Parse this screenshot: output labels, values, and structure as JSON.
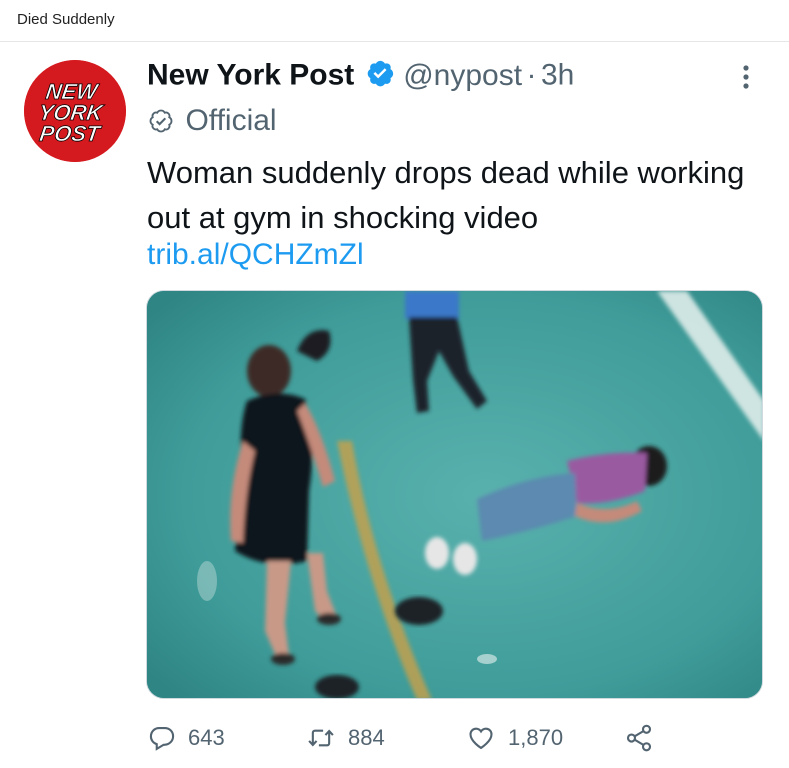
{
  "page": {
    "title": "Died Suddenly"
  },
  "tweet": {
    "author_name": "New York Post",
    "handle": "@nypost",
    "separator": "·",
    "time": "3h",
    "official_label": "Official",
    "text": "Woman suddenly drops dead while working out at gym in shocking video",
    "link": "trib.al/QCHZmZl",
    "avatar_text": [
      "NEW",
      "YORK",
      "POST"
    ],
    "verified_icon": "verified-badge-icon",
    "media_description_icon": "gym-video-thumbnail",
    "stats": {
      "replies": "643",
      "retweets": "884",
      "likes": "1,870"
    }
  },
  "colors": {
    "brand_red": "#d51a1f",
    "link_blue": "#1d9bf0",
    "verified_blue": "#1d9bf0",
    "secondary_text": "#536471",
    "primary_text": "#0f1419"
  },
  "icons": {
    "reply": "reply-icon",
    "retweet": "retweet-icon",
    "like": "heart-icon",
    "share": "share-icon",
    "more": "more-options-icon",
    "official": "official-badge-icon"
  }
}
